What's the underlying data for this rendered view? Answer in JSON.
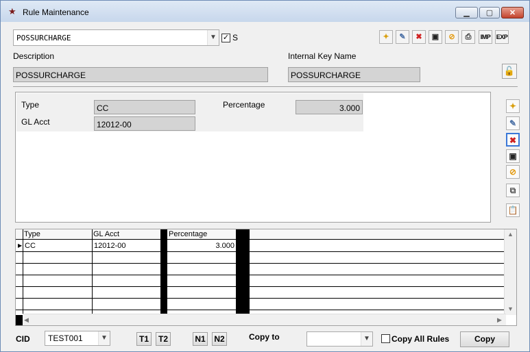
{
  "window": {
    "title": "Rule Maintenance"
  },
  "rule_select": {
    "value": "POSSURCHARGE",
    "s_checked": true,
    "s_label": "S"
  },
  "toolbar": {
    "buttons": [
      {
        "icon": "new-icon"
      },
      {
        "icon": "edit-icon"
      },
      {
        "icon": "delete-icon"
      },
      {
        "icon": "save-icon"
      },
      {
        "icon": "cancel-icon"
      },
      {
        "icon": "print-icon"
      },
      {
        "label": "IMP"
      },
      {
        "label": "EXP"
      }
    ]
  },
  "header": {
    "description_label": "Description",
    "description_value": "POSSURCHARGE",
    "internal_key_label": "Internal Key Name",
    "internal_key_value": "POSSURCHARGE"
  },
  "detail": {
    "type_label": "Type",
    "type_value": "CC",
    "gl_label": "GL Acct",
    "gl_value": "12012-00",
    "percentage_label": "Percentage",
    "percentage_value": "3.000"
  },
  "grid": {
    "columns": [
      "Type",
      "GL Acct",
      "Percentage"
    ],
    "rows": [
      {
        "type": "CC",
        "gl": "12012-00",
        "percentage": "3.000"
      }
    ]
  },
  "footer": {
    "cid_label": "CID",
    "cid_value": "TEST001",
    "t1": "T1",
    "t2": "T2",
    "n1": "N1",
    "n2": "N2",
    "copy_to_label": "Copy to",
    "copy_to_value": "",
    "copy_all_label": "Copy All Rules",
    "copy_all_checked": false,
    "copy_button": "Copy"
  }
}
